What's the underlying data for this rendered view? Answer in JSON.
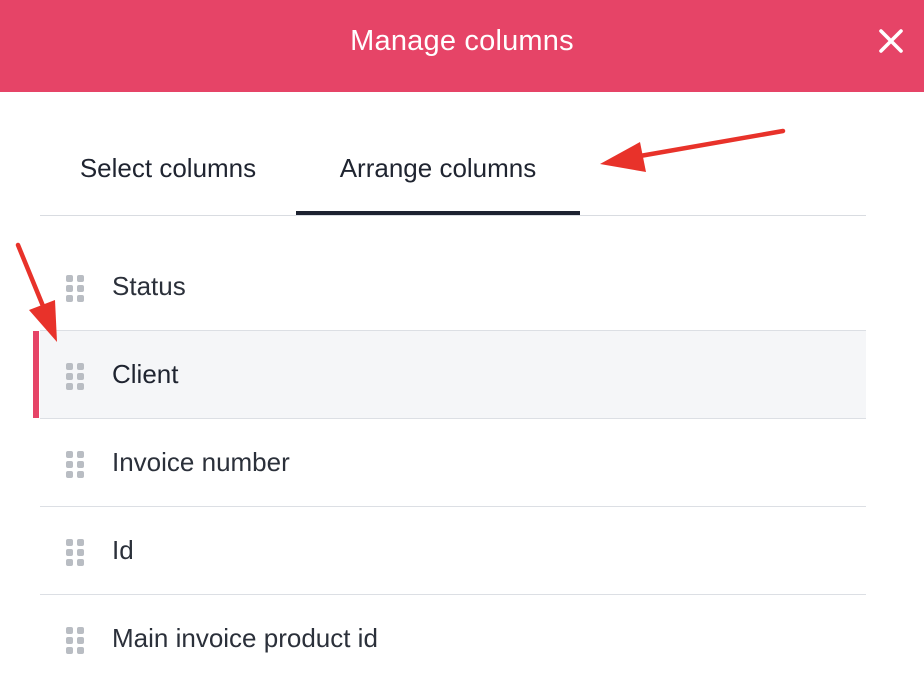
{
  "dialog": {
    "title": "Manage columns",
    "close_icon": "close-icon"
  },
  "tabs": [
    {
      "label": "Select columns",
      "active": false
    },
    {
      "label": "Arrange columns",
      "active": true
    }
  ],
  "columns": [
    {
      "label": "Status",
      "highlighted": false
    },
    {
      "label": "Client",
      "highlighted": true
    },
    {
      "label": "Invoice number",
      "highlighted": false
    },
    {
      "label": "Id",
      "highlighted": false
    },
    {
      "label": "Main invoice product id",
      "highlighted": false
    }
  ],
  "colors": {
    "header": "#e64467",
    "highlight_bar": "#e64467",
    "active_tab_underline": "#1d2230",
    "annotation_arrow": "#e8322a"
  },
  "icons": {
    "drag_handle": "drag-handle-icon"
  }
}
